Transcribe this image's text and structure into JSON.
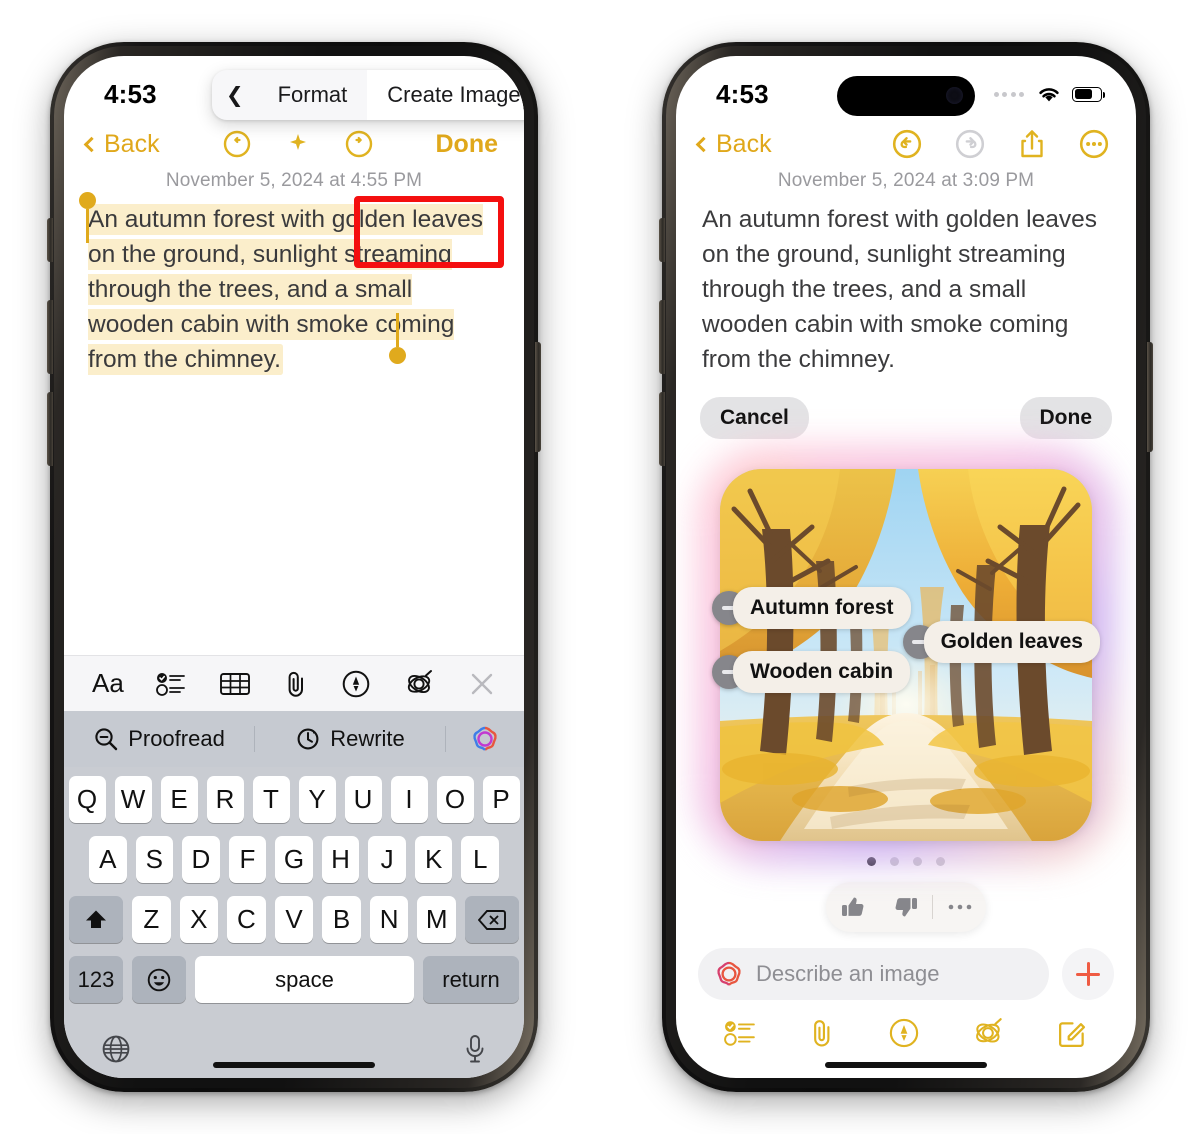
{
  "left_phone": {
    "status": {
      "time": "4:53",
      "signal_icon": "signal-dots-icon",
      "wifi_icon": "wifi-icon",
      "battery_icon": "battery-icon"
    },
    "nav": {
      "back_label": "Back",
      "done_label": "Done",
      "back_icon": "chevron-left-icon"
    },
    "timestamp": "November 5, 2024 at 4:55 PM",
    "note_text": "An autumn forest with golden leaves on the ground, sunlight streaming through the trees, and a small wooden cabin with smoke coming from the chimney.",
    "context_menu": {
      "prev_icon": "chevron-left-icon",
      "items": [
        "Format",
        "Create Image"
      ],
      "next_icon": "chevron-right-icon",
      "highlighted": "Create Image",
      "highlight_color": "#f40f0f"
    },
    "format_toolbar": [
      {
        "name": "text-format-icon",
        "label": "Aa"
      },
      {
        "name": "checklist-icon",
        "label": ""
      },
      {
        "name": "table-icon",
        "label": ""
      },
      {
        "name": "paperclip-icon",
        "label": ""
      },
      {
        "name": "markup-pen-icon",
        "label": ""
      },
      {
        "name": "apple-intelligence-icon",
        "label": ""
      },
      {
        "name": "close-icon",
        "label": ""
      }
    ],
    "ai_bar": {
      "proofread_label": "Proofread",
      "rewrite_label": "Rewrite",
      "proofread_icon": "magnifier-check-icon",
      "rewrite_icon": "rewrite-clock-icon",
      "sparkle_icon": "apple-intelligence-glyph-icon"
    },
    "keyboard": {
      "row1": [
        "Q",
        "W",
        "E",
        "R",
        "T",
        "Y",
        "U",
        "I",
        "O",
        "P"
      ],
      "row2": [
        "A",
        "S",
        "D",
        "F",
        "G",
        "H",
        "J",
        "K",
        "L"
      ],
      "row3": [
        "Z",
        "X",
        "C",
        "V",
        "B",
        "N",
        "M"
      ],
      "shift_icon": "shift-up-icon",
      "delete_icon": "backspace-icon",
      "numeric_label": "123",
      "emoji_icon": "emoji-smiley-icon",
      "space_label": "space",
      "return_label": "return",
      "globe_icon": "globe-icon",
      "mic_icon": "microphone-icon"
    }
  },
  "right_phone": {
    "status": {
      "time": "4:53",
      "signal_icon": "signal-dots-icon",
      "wifi_icon": "wifi-icon",
      "battery_icon": "battery-icon"
    },
    "nav": {
      "back_label": "Back",
      "back_icon": "chevron-left-icon",
      "undo_icon": "undo-icon",
      "redo_icon": "redo-icon",
      "share_icon": "share-icon",
      "more_icon": "more-ellipsis-icon",
      "undo_enabled": true,
      "redo_enabled": false
    },
    "timestamp": "November 5, 2024 at 3:09 PM",
    "note_text": "An autumn forest with golden leaves on the ground, sunlight streaming through the trees, and a small wooden cabin with smoke coming from the chimney.",
    "actions": {
      "cancel_label": "Cancel",
      "done_label": "Done"
    },
    "image": {
      "alt": "Generated illustration of an autumn forest path with golden leaves",
      "concept_chips": [
        {
          "label": "Autumn forest",
          "remove_icon": "minus-circle-icon"
        },
        {
          "label": "Wooden cabin",
          "remove_icon": "minus-circle-icon"
        },
        {
          "label": "Golden leaves",
          "remove_icon": "minus-circle-icon"
        }
      ],
      "page_count": 4,
      "active_page": 1,
      "glow_colors": [
        "#ffc4d2",
        "#f3b7e0",
        "#c7a9ee",
        "#ffd2b9"
      ]
    },
    "feedback": {
      "thumbs_up_icon": "thumbs-up-icon",
      "thumbs_down_icon": "thumbs-down-icon",
      "more_icon": "more-ellipsis-icon"
    },
    "describe_input": {
      "placeholder": "Describe an image",
      "leading_icon": "apple-intelligence-glyph-icon",
      "add_icon": "plus-icon",
      "add_color": "#ef5b43"
    },
    "bottom_toolbar": [
      {
        "name": "checklist-icon"
      },
      {
        "name": "paperclip-icon"
      },
      {
        "name": "markup-pen-icon"
      },
      {
        "name": "apple-intelligence-icon"
      },
      {
        "name": "compose-icon"
      }
    ]
  }
}
